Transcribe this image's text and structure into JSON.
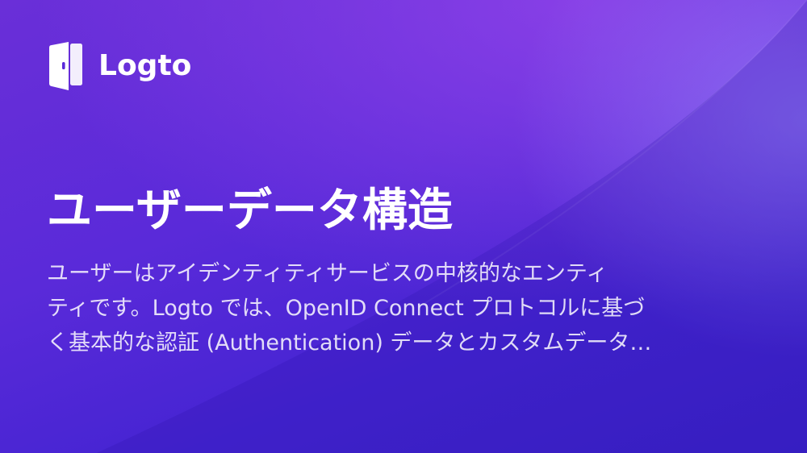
{
  "brand": {
    "name": "Logto",
    "icon": "logto-door-icon"
  },
  "title": "ユーザーデータ構造",
  "description": {
    "lines": [
      "ユーザーはアイデンティティサービスの中核的なエンティ",
      "ティです。Logto では、OpenID Connect プロトコルに基づ",
      "く基本的な認証 (Authentication) データとカスタムデータ…"
    ]
  },
  "colors": {
    "background_top": "#6a2fd8",
    "background_bottom": "#3a22c8",
    "text": "#ffffff"
  }
}
